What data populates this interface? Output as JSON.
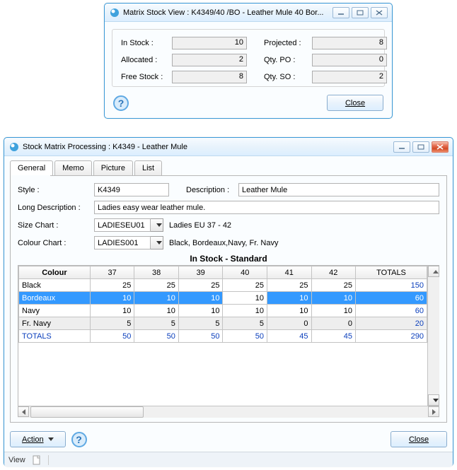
{
  "viewWindow": {
    "title": "Matrix Stock View : K4349/40  /BO - Leather Mule 40 Bor...",
    "fields": {
      "inStockLabel": "In Stock :",
      "inStockValue": "10",
      "allocatedLabel": "Allocated :",
      "allocatedValue": "2",
      "freeStockLabel": "Free Stock :",
      "freeStockValue": "8",
      "projectedLabel": "Projected :",
      "projectedValue": "8",
      "qtyPoLabel": "Qty. PO :",
      "qtyPoValue": "0",
      "qtySoLabel": "Qty. SO :",
      "qtySoValue": "2"
    },
    "closeBtn": "Close"
  },
  "mainWindow": {
    "title": "Stock Matrix Processing : K4349 - Leather Mule",
    "tabs": {
      "general": "General",
      "memo": "Memo",
      "picture": "Picture",
      "list": "List"
    },
    "form": {
      "styleLabel": "Style :",
      "styleValue": "K4349",
      "descLabel": "Description :",
      "descValue": "Leather Mule",
      "longDescLabel": "Long Description :",
      "longDescValue": "Ladies easy wear leather mule.",
      "sizeChartLabel": "Size Chart :",
      "sizeChartValue": "LADIESEU01",
      "sizeChartText": "Ladies EU 37 - 42",
      "colourChartLabel": "Colour Chart :",
      "colourChartValue": "LADIES001",
      "colourChartText": "Black, Bordeaux,Navy, Fr. Navy"
    },
    "gridTitle": "In Stock - Standard",
    "grid": {
      "colourHeader": "Colour",
      "sizeHeaders": [
        "37",
        "38",
        "39",
        "40",
        "41",
        "42"
      ],
      "totalsHeader": "TOTALS",
      "rows": [
        {
          "name": "Black",
          "vals": [
            "25",
            "25",
            "25",
            "25",
            "25",
            "25"
          ],
          "total": "150"
        },
        {
          "name": "Bordeaux",
          "vals": [
            "10",
            "10",
            "10",
            "10",
            "10",
            "10"
          ],
          "total": "60"
        },
        {
          "name": "Navy",
          "vals": [
            "10",
            "10",
            "10",
            "10",
            "10",
            "10"
          ],
          "total": "60"
        },
        {
          "name": "Fr. Navy",
          "vals": [
            "5",
            "5",
            "5",
            "5",
            "0",
            "0"
          ],
          "total": "20"
        }
      ],
      "totalsRow": {
        "name": "TOTALS",
        "vals": [
          "50",
          "50",
          "50",
          "50",
          "45",
          "45"
        ],
        "total": "290"
      }
    },
    "actionBtn": "Action",
    "closeBtn": "Close",
    "statusLabel": "View"
  }
}
